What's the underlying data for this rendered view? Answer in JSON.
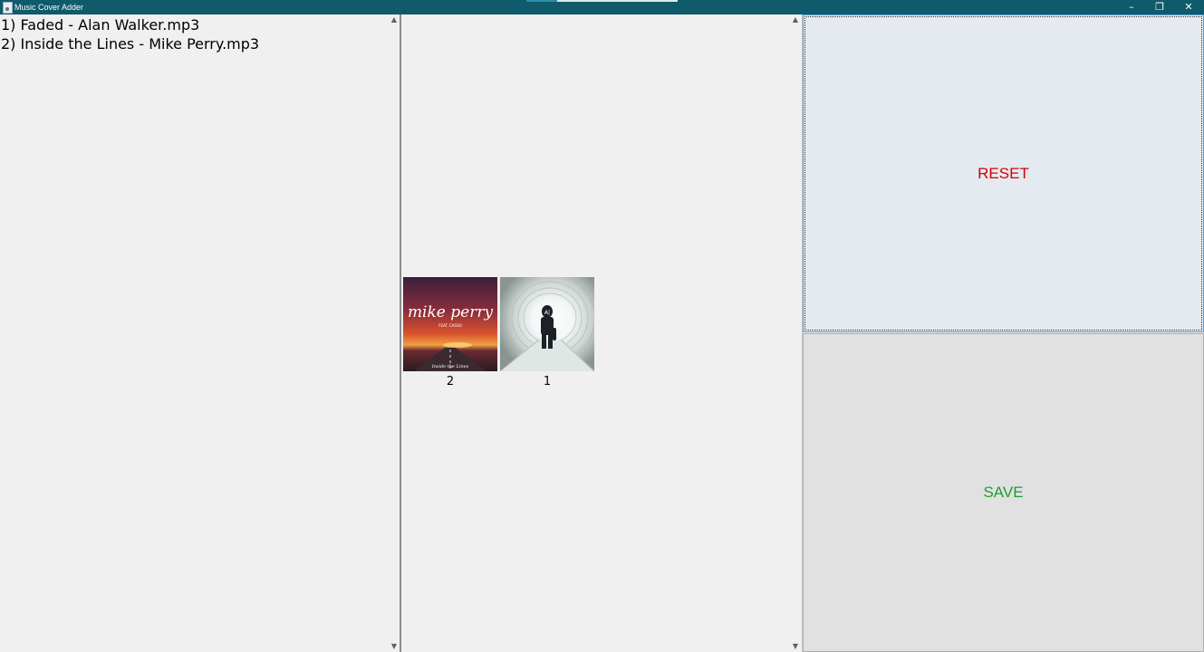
{
  "window": {
    "title": "Music Cover Adder",
    "icon": "app-icon",
    "controls": {
      "minimize": "–",
      "maximize": "❐",
      "close": "✕"
    }
  },
  "file_list": {
    "items": [
      "1) Faded - Alan Walker.mp3",
      "2) Inside the Lines - Mike Perry.mp3"
    ]
  },
  "covers": [
    {
      "label": "2",
      "art_title": "mike perry",
      "art_feat": "FEAT. CASSO",
      "art_song": "Inside the Lines"
    },
    {
      "label": "1",
      "art_logo": "A|"
    }
  ],
  "buttons": {
    "reset_label": "RESET",
    "save_label": "SAVE"
  },
  "colors": {
    "titlebar": "#0f5a6b",
    "reset_text": "#d40000",
    "save_text": "#1aa032"
  }
}
